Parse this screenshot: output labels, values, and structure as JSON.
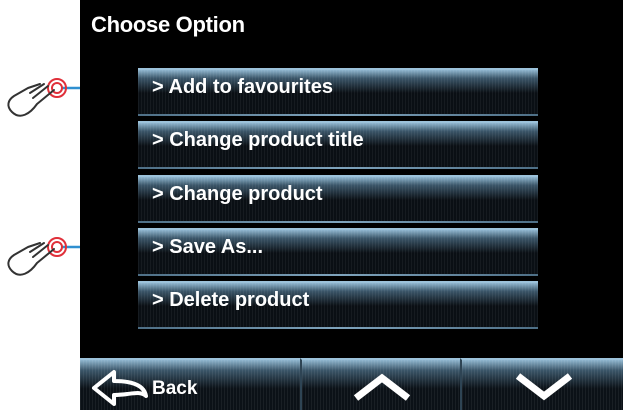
{
  "screen": {
    "title": "Choose Option"
  },
  "menu": {
    "items": [
      {
        "label": "> Add to favourites"
      },
      {
        "label": "> Change product title"
      },
      {
        "label": "> Change product"
      },
      {
        "label": "> Save As..."
      },
      {
        "label": "> Delete product"
      }
    ]
  },
  "footer": {
    "back_label": "Back",
    "back_icon": "back-arrow-icon",
    "up_icon": "chevron-up-icon",
    "down_icon": "chevron-down-icon"
  },
  "colors": {
    "screen_bg": "#000000",
    "button_highlight": "#9cc2da",
    "pointer_ring": "#e0303a",
    "connector": "#2f8fd0"
  }
}
